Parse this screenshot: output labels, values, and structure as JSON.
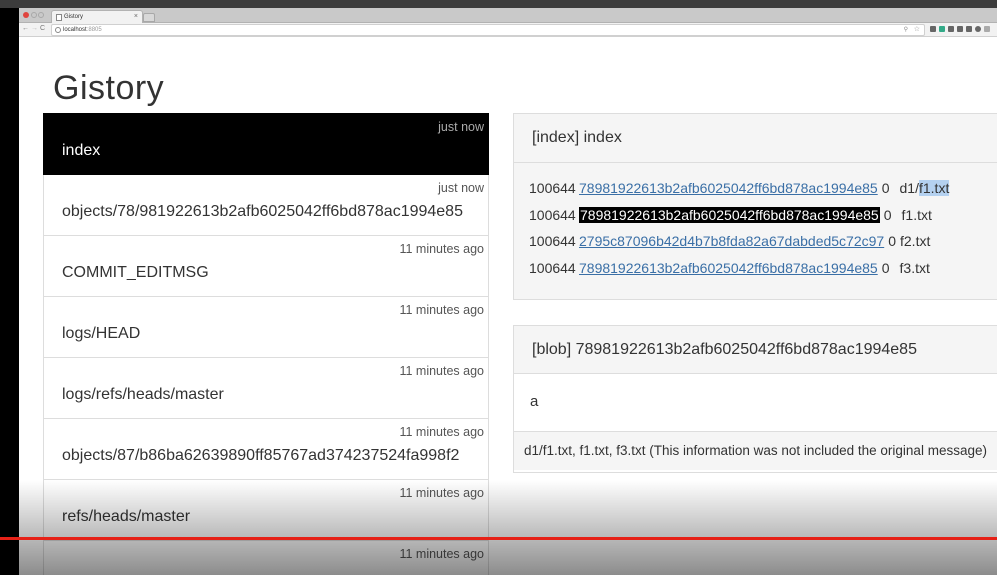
{
  "browser": {
    "tab_title": "Gistory",
    "tab_close": "×",
    "nav_back": "←",
    "nav_forward": "→",
    "nav_reload": "C",
    "url_host": "localhost",
    "url_port": ":8805",
    "zoom_icon": "zoom-icon",
    "star_icon": "star-icon"
  },
  "page": {
    "title": "Gistory",
    "list": [
      {
        "name": "index",
        "time": "just now",
        "active": true
      },
      {
        "name": "objects/78/981922613b2afb6025042ff6bd878ac1994e85",
        "time": "just now"
      },
      {
        "name": "COMMIT_EDITMSG",
        "time": "11 minutes ago"
      },
      {
        "name": "logs/HEAD",
        "time": "11 minutes ago"
      },
      {
        "name": "logs/refs/heads/master",
        "time": "11 minutes ago"
      },
      {
        "name": "objects/87/b86ba62639890ff85767ad374237524fa998f2",
        "time": "11 minutes ago"
      },
      {
        "name": "refs/heads/master",
        "time": "11 minutes ago"
      },
      {
        "name": "",
        "time": "11 minutes ago"
      }
    ],
    "index_panel": {
      "header": "[index] index",
      "entries": [
        {
          "mode": "100644",
          "hash": "78981922613b2afb6025042ff6bd878ac1994e85",
          "stage": "0",
          "path_prefix": "d1/",
          "path_name": "f1.txt"
        },
        {
          "mode": "100644",
          "hash": "78981922613b2afb6025042ff6bd878ac1994e85",
          "stage": "0",
          "path_prefix": "",
          "path_name": "f1.txt"
        },
        {
          "mode": "100644",
          "hash": "2795c87096b42d4b7b8fda82a67dabded5c72c97",
          "stage": "0",
          "path_prefix": "",
          "path_name": "f2.txt"
        },
        {
          "mode": "100644",
          "hash": "78981922613b2afb6025042ff6bd878ac1994e85",
          "stage": "0",
          "path_prefix": "",
          "path_name": "f3.txt"
        }
      ]
    },
    "blob_panel": {
      "header": "[blob] 78981922613b2afb6025042ff6bd878ac1994e85",
      "content": "a",
      "footer": "d1/f1.txt, f1.txt, f3.txt (This information was not included the original message)"
    }
  },
  "colors": {
    "active_item_bg": "#000000",
    "link": "#3a6fa6",
    "text_selection": "#b4d1f0",
    "progress_bar": "#e62117"
  }
}
